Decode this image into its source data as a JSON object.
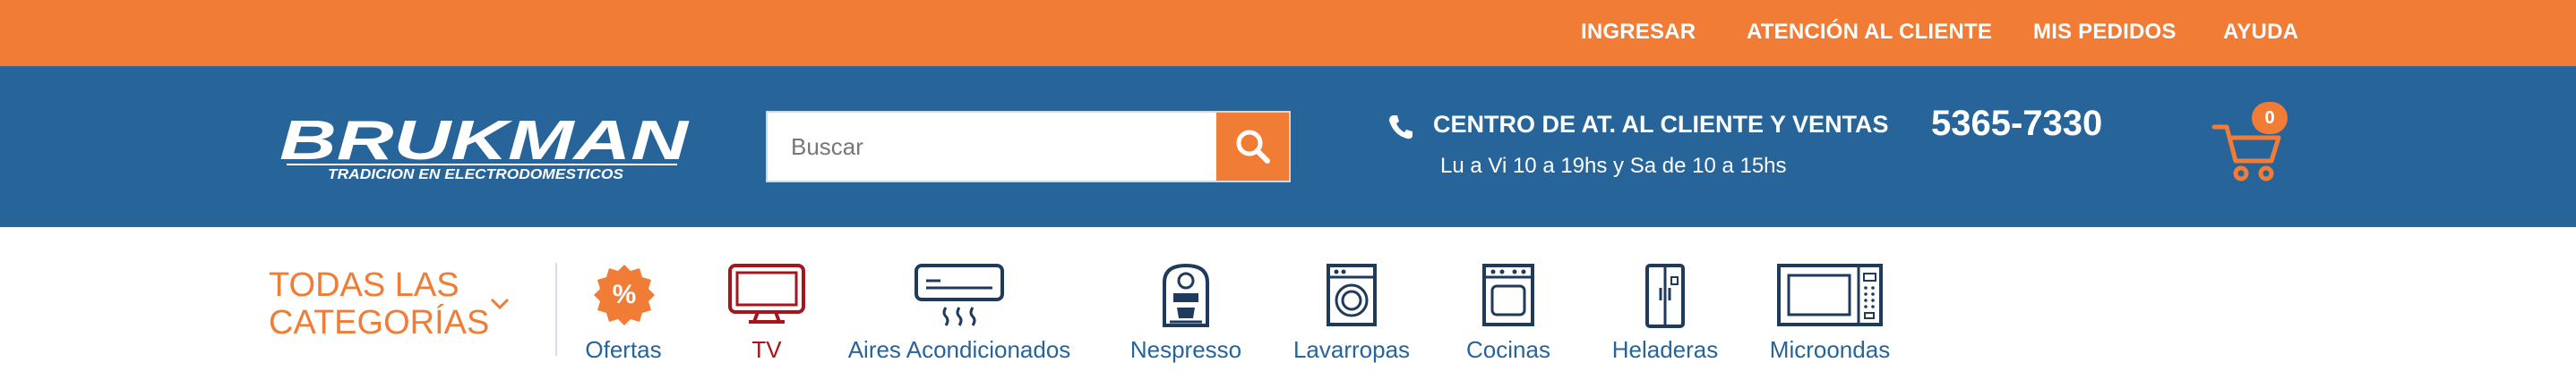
{
  "topbar": {
    "links": [
      "INGRESAR",
      "ATENCIÓN AL CLIENTE",
      "MIS PEDIDOS",
      "AYUDA"
    ]
  },
  "header": {
    "logo": {
      "brand": "BRUKMAN",
      "tagline": "TRADICION EN ELECTRODOMESTICOS"
    },
    "search": {
      "placeholder": "Buscar",
      "value": ""
    },
    "contact": {
      "title": "CENTRO DE AT. AL CLIENTE Y VENTAS",
      "hours": "Lu a Vi 10 a 19hs y Sa de 10 a 15hs",
      "phone": "5365-7330"
    },
    "cart": {
      "count": "0"
    }
  },
  "categories_nav": {
    "all_label_line1": "TODAS LAS",
    "all_label_line2": "CATEGORÍAS",
    "items": [
      {
        "label": "Ofertas",
        "icon": "percent-badge-icon"
      },
      {
        "label": "TV",
        "icon": "tv-icon"
      },
      {
        "label": "Aires Acondicionados",
        "icon": "air-conditioner-icon"
      },
      {
        "label": "Nespresso",
        "icon": "coffee-machine-icon"
      },
      {
        "label": "Lavarropas",
        "icon": "washing-machine-icon"
      },
      {
        "label": "Cocinas",
        "icon": "stove-icon"
      },
      {
        "label": "Heladeras",
        "icon": "refrigerator-icon"
      },
      {
        "label": "Microondas",
        "icon": "microwave-icon"
      }
    ]
  },
  "colors": {
    "orange": "#f07c36",
    "blue": "#26649a",
    "tv_red": "#a4151c"
  }
}
